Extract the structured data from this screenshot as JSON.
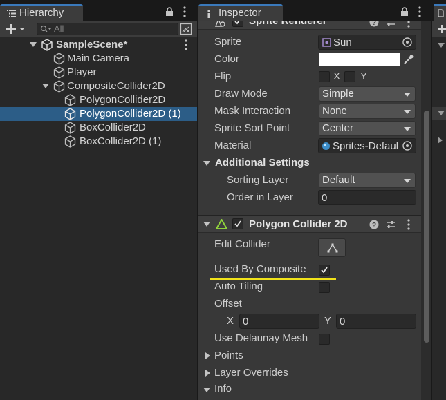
{
  "hierarchy": {
    "tab_label": "Hierarchy",
    "search_placeholder": "All",
    "items": [
      {
        "label": "SampleScene*"
      },
      {
        "label": "Main Camera"
      },
      {
        "label": "Player"
      },
      {
        "label": "CompositeCollider2D"
      },
      {
        "label": "PolygonCollider2D"
      },
      {
        "label": "PolygonCollider2D (1)",
        "selected": true
      },
      {
        "label": "BoxCollider2D"
      },
      {
        "label": "BoxCollider2D (1)"
      }
    ]
  },
  "inspector": {
    "tab_label": "Inspector",
    "sprite_renderer": {
      "title": "Sprite Renderer",
      "sprite_label": "Sprite",
      "sprite_value": "Sun",
      "color_label": "Color",
      "color_value": "#ffffff",
      "flip_label": "Flip",
      "flip_x": "X",
      "flip_y": "Y",
      "draw_mode_label": "Draw Mode",
      "draw_mode_value": "Simple",
      "mask_label": "Mask Interaction",
      "mask_value": "None",
      "sort_point_label": "Sprite Sort Point",
      "sort_point_value": "Center",
      "material_label": "Material",
      "material_value": "Sprites-Default",
      "additional_settings": "Additional Settings",
      "sorting_layer_label": "Sorting Layer",
      "sorting_layer_value": "Default",
      "order_label": "Order in Layer",
      "order_value": "0"
    },
    "polygon_collider": {
      "title": "Polygon Collider 2D",
      "edit_collider_label": "Edit Collider",
      "used_by_composite_label": "Used By Composite",
      "used_by_composite": true,
      "auto_tiling_label": "Auto Tiling",
      "auto_tiling": false,
      "offset_label": "Offset",
      "offset_x_label": "X",
      "offset_x": "0",
      "offset_y_label": "Y",
      "offset_y": "0",
      "delaunay_label": "Use Delaunay Mesh",
      "use_delaunay": false,
      "points_label": "Points",
      "layer_overrides_label": "Layer Overrides",
      "info_label": "Info"
    }
  },
  "colors": {
    "selection": "#2c5d87",
    "highlight_underline": "#f1e31a",
    "accent_tab": "#3a79bb"
  }
}
